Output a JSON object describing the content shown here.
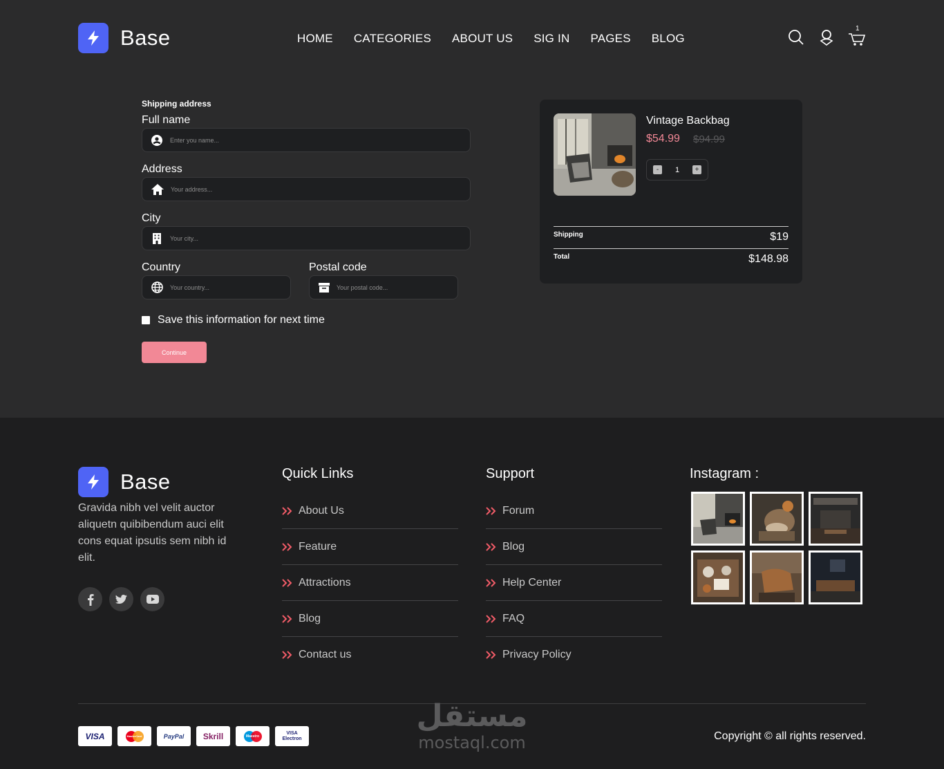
{
  "brand": {
    "name": "Base"
  },
  "nav": {
    "items": [
      "HOME",
      "CATEGORIES",
      "ABOUT US",
      "SIG IN",
      "PAGES",
      "BLOG"
    ]
  },
  "cart": {
    "count": "1"
  },
  "form": {
    "section_label": "Shipping address",
    "full_name": {
      "label": "Full name",
      "placeholder": "Enter you name..."
    },
    "address": {
      "label": "Address",
      "placeholder": "Your address..."
    },
    "city": {
      "label": "City",
      "placeholder": "Your city..."
    },
    "country": {
      "label": "Country",
      "placeholder": "Your country..."
    },
    "postal": {
      "label": "Postal code",
      "placeholder": "Your postal code..."
    },
    "save_label": "Save this information for next time",
    "continue_label": "Continue"
  },
  "order": {
    "product_title": "Vintage Backbag",
    "price": "$54.99",
    "old_price": "$94.99",
    "qty_minus": "-",
    "qty_plus": "+",
    "quantity": "1",
    "shipping_label": "Shipping",
    "shipping_value": "$19",
    "total_label": "Total",
    "total_value": "$148.98"
  },
  "footer": {
    "description": "Gravida nibh vel velit auctor aliquetn quibibendum auci elit cons equat ipsutis sem nibh id elit.",
    "quick_links": {
      "title": "Quick Links",
      "items": [
        "About Us",
        "Feature",
        "Attractions",
        "Blog",
        "Contact us"
      ]
    },
    "support": {
      "title": "Support",
      "items": [
        "Forum",
        "Blog",
        "Help Center",
        "FAQ",
        "Privacy Policy"
      ]
    },
    "instagram": {
      "title": "Instagram :"
    },
    "payments": [
      "VISA",
      "MasterCard",
      "PayPal",
      "Skrill",
      "Maestro",
      "VISA Electron"
    ],
    "copyright": "Copyright © all rights reserved."
  },
  "watermark": {
    "arabic": "مستقل",
    "latin": "mostaql.com"
  },
  "colors": {
    "accent": "#4f64f5",
    "price": "#f28896",
    "button": "#f28896"
  }
}
